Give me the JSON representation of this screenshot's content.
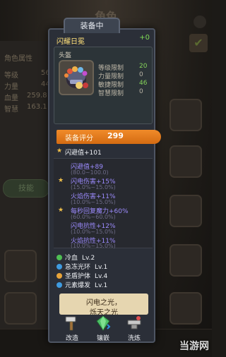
{
  "background": {
    "screen_title": "角色",
    "panel_title": "角色属性",
    "rows": [
      {
        "label": "等级",
        "value": "56"
      },
      {
        "label": "力量",
        "value": "44"
      },
      {
        "label": "血量",
        "value": "259.8"
      },
      {
        "label": "智慧",
        "value": "163.1"
      }
    ],
    "side_button": "技能"
  },
  "popup": {
    "tab_label": "装备中",
    "item_name": "闪耀日冕",
    "plus_label": "+0",
    "slot_type": "头盔",
    "requirements": [
      {
        "label": "等级限制",
        "value": "20"
      },
      {
        "label": "力量限制",
        "value": "0"
      },
      {
        "label": "敏捷限制",
        "value": "46"
      },
      {
        "label": "智慧限制",
        "value": "0"
      }
    ],
    "score_label": "装备评分",
    "score_value": "299",
    "main_stat": "闪避值+101",
    "stats": [
      {
        "text": "闪避值+89",
        "range": "(80.0~100.0)",
        "star": false
      },
      {
        "text": "闪电伤害+15%",
        "range": "(15.0%~15.0%)",
        "star": true
      },
      {
        "text": "火焰伤害+11%",
        "range": "(10.0%~15.0%)",
        "star": false
      },
      {
        "text": "每秒回复魔力+60%",
        "range": "(60.0%~60.0%)",
        "star": true
      },
      {
        "text": "闪电抗性+12%",
        "range": "(10.0%~15.0%)",
        "star": false
      },
      {
        "text": "火焰抗性+11%",
        "range": "(10.0%~15.0%)",
        "star": false
      }
    ],
    "skills": [
      {
        "name": "冷血",
        "level": "Lv.2",
        "color": "#4fbf54"
      },
      {
        "name": "急冻光环",
        "level": "Lv.1",
        "color": "#3f9be0"
      },
      {
        "name": "圣盾护体",
        "level": "Lv.4",
        "color": "#e8a43a"
      },
      {
        "name": "元素爆发",
        "level": "Lv.1",
        "color": "#3f9be0"
      }
    ],
    "description_line1": "闪电之光，",
    "description_line2": "烁天之光",
    "actions": [
      {
        "label": "改造",
        "icon": "hammer-icon"
      },
      {
        "label": "镶嵌",
        "icon": "gem-icon"
      },
      {
        "label": "洗炼",
        "icon": "anvil-icon"
      }
    ]
  },
  "watermark": "当游网",
  "colors": {
    "accent_orange": "#e67a1e",
    "stat_purple": "#9d8cff",
    "name_yellow": "#ffe07a",
    "req_green": "#85d35a"
  }
}
